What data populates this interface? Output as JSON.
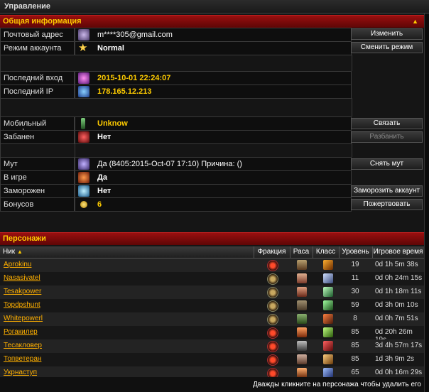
{
  "window": {
    "title": "Управление"
  },
  "general": {
    "title": "Общая информация",
    "email": {
      "label": "Почтовый адрес",
      "value": "m****305@gmail.com",
      "button": "Изменить"
    },
    "mode": {
      "label": "Режим аккаунта",
      "value": "Normal",
      "button": "Сменить режим"
    },
    "last_login": {
      "label": "Последний вход",
      "value": "2015-10-01 22:24:07"
    },
    "last_ip": {
      "label": "Последний IP",
      "value": "178.165.12.213"
    },
    "phone": {
      "label": "Мобильный телефон",
      "value": "Unknow",
      "button": "Связать"
    },
    "banned": {
      "label": "Забанен",
      "value": "Нет",
      "button": "Разбанить"
    },
    "mute": {
      "label": "Мут",
      "value": "Да (8405:2015-Oct-07 17:10) Причина: ()",
      "button": "Снять мут"
    },
    "ingame": {
      "label": "В игре",
      "value": "Да"
    },
    "frozen": {
      "label": "Заморожен",
      "value": "Нет",
      "button": "Заморозить аккаунт"
    },
    "bonus": {
      "label": "Бонусов",
      "value": "6",
      "button": "Пожертвовать"
    }
  },
  "characters": {
    "title": "Персонажи",
    "columns": {
      "name": "Ник",
      "faction": "Фракция",
      "race": "Раса",
      "class": "Класс",
      "level": "Уровень",
      "time": "Игровое время"
    },
    "rows": [
      {
        "name": "Aprokinu",
        "level": "19",
        "time": "0d 1h 5m 38s"
      },
      {
        "name": "Nasasivatel",
        "level": "11",
        "time": "0d 0h 24m 15s"
      },
      {
        "name": "Tesakpower",
        "level": "30",
        "time": "0d 1h 18m 11s"
      },
      {
        "name": "Topdpshunt",
        "level": "59",
        "time": "0d 3h 0m 10s"
      },
      {
        "name": "Whitepowerl",
        "level": "8",
        "time": "0d 0h 7m 51s"
      },
      {
        "name": "Рогакилер",
        "level": "85",
        "time": "0d 20h 26m 19s"
      },
      {
        "name": "Тесакловер",
        "level": "85",
        "time": "3d 4h 57m 17s"
      },
      {
        "name": "Топветеран",
        "level": "85",
        "time": "1d 3h 9m 2s"
      },
      {
        "name": "Укрнаступ",
        "level": "65",
        "time": "0d 0h 16m 29s"
      }
    ],
    "footer": "Дважды кликните на персонажа чтобы удалить его"
  }
}
